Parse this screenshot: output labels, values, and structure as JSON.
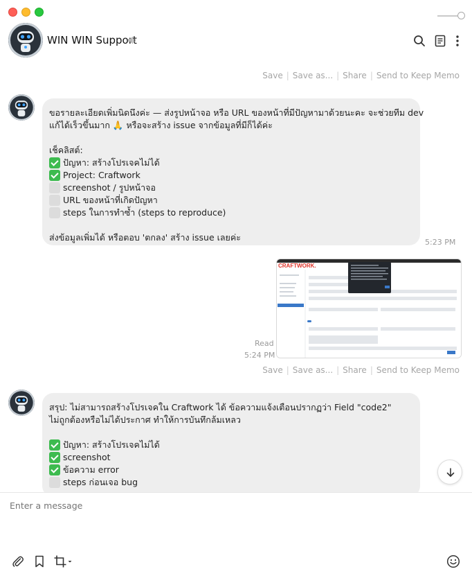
{
  "window": {
    "controls": [
      "close",
      "minimize",
      "maximize"
    ]
  },
  "header": {
    "title": "WIN WIN Support",
    "icons": [
      "robot-avatar",
      "speaker-icon",
      "search-icon",
      "notes-icon",
      "more-icon"
    ]
  },
  "actions_labels": {
    "save": "Save",
    "save_as": "Save as...",
    "share": "Share",
    "keep": "Send to Keep Memo"
  },
  "messages": [
    {
      "from": "bot",
      "intro1": "ขอรายละเอียดเพิ่มนิดนึงค่ะ — ส่งรูปหน้าจอ หรือ URL ของหน้าที่มีปัญหามาด้วยนะคะ จะช่วยทีม dev",
      "intro2": "แก้ได้เร็วขึ้นมาก 🙏 หรือจะสร้าง issue จากข้อมูลที่มีก็ได้ค่ะ",
      "checklist_title": "เช็คลิสต์:",
      "items": [
        {
          "done": true,
          "text": "ปัญหา: สร้างโปรเจคไม่ได้"
        },
        {
          "done": true,
          "text": "Project: Craftwork"
        },
        {
          "done": false,
          "text": "screenshot / รูปหน้าจอ"
        },
        {
          "done": false,
          "text": "URL ของหน้าที่เกิดปัญหา"
        },
        {
          "done": false,
          "text": "steps ในการทำซ้ำ (steps to reproduce)"
        }
      ],
      "footer": "ส่งข้อมูลเพิ่มได้ หรือตอบ 'ตกลง' สร้าง issue เลยค่ะ",
      "time": "5:23 PM"
    },
    {
      "from": "me",
      "status": "Read",
      "time": "5:24 PM",
      "image": {
        "brand": "CRAFTWORK."
      }
    },
    {
      "from": "bot",
      "summary1": "สรุป: ไม่สามารถสร้างโปรเจคใน Craftwork ได้ ข้อความแจ้งเตือนปรากฏว่า Field \"code2\"",
      "summary2": "ไม่ถูกต้องหรือไม่ได้ประกาศ ทำให้การบันทึกล้มเหลว",
      "items": [
        {
          "done": true,
          "text": "ปัญหา: สร้างโปรเจคไม่ได้"
        },
        {
          "done": true,
          "text": "screenshot"
        },
        {
          "done": true,
          "text": "ข้อความ error"
        },
        {
          "done": false,
          "text": "steps ก่อนเจอ bug"
        }
      ]
    }
  ],
  "composer": {
    "placeholder": "Enter a message",
    "tools": [
      "paperclip-icon",
      "bookmark-icon",
      "crop-icon",
      "emoji-icon"
    ]
  },
  "colors": {
    "bubble": "#eeeeee",
    "check_done": "#3dbb4f",
    "check_todo": "#dcdcdc",
    "craftwork_accent": "#e0342a"
  }
}
